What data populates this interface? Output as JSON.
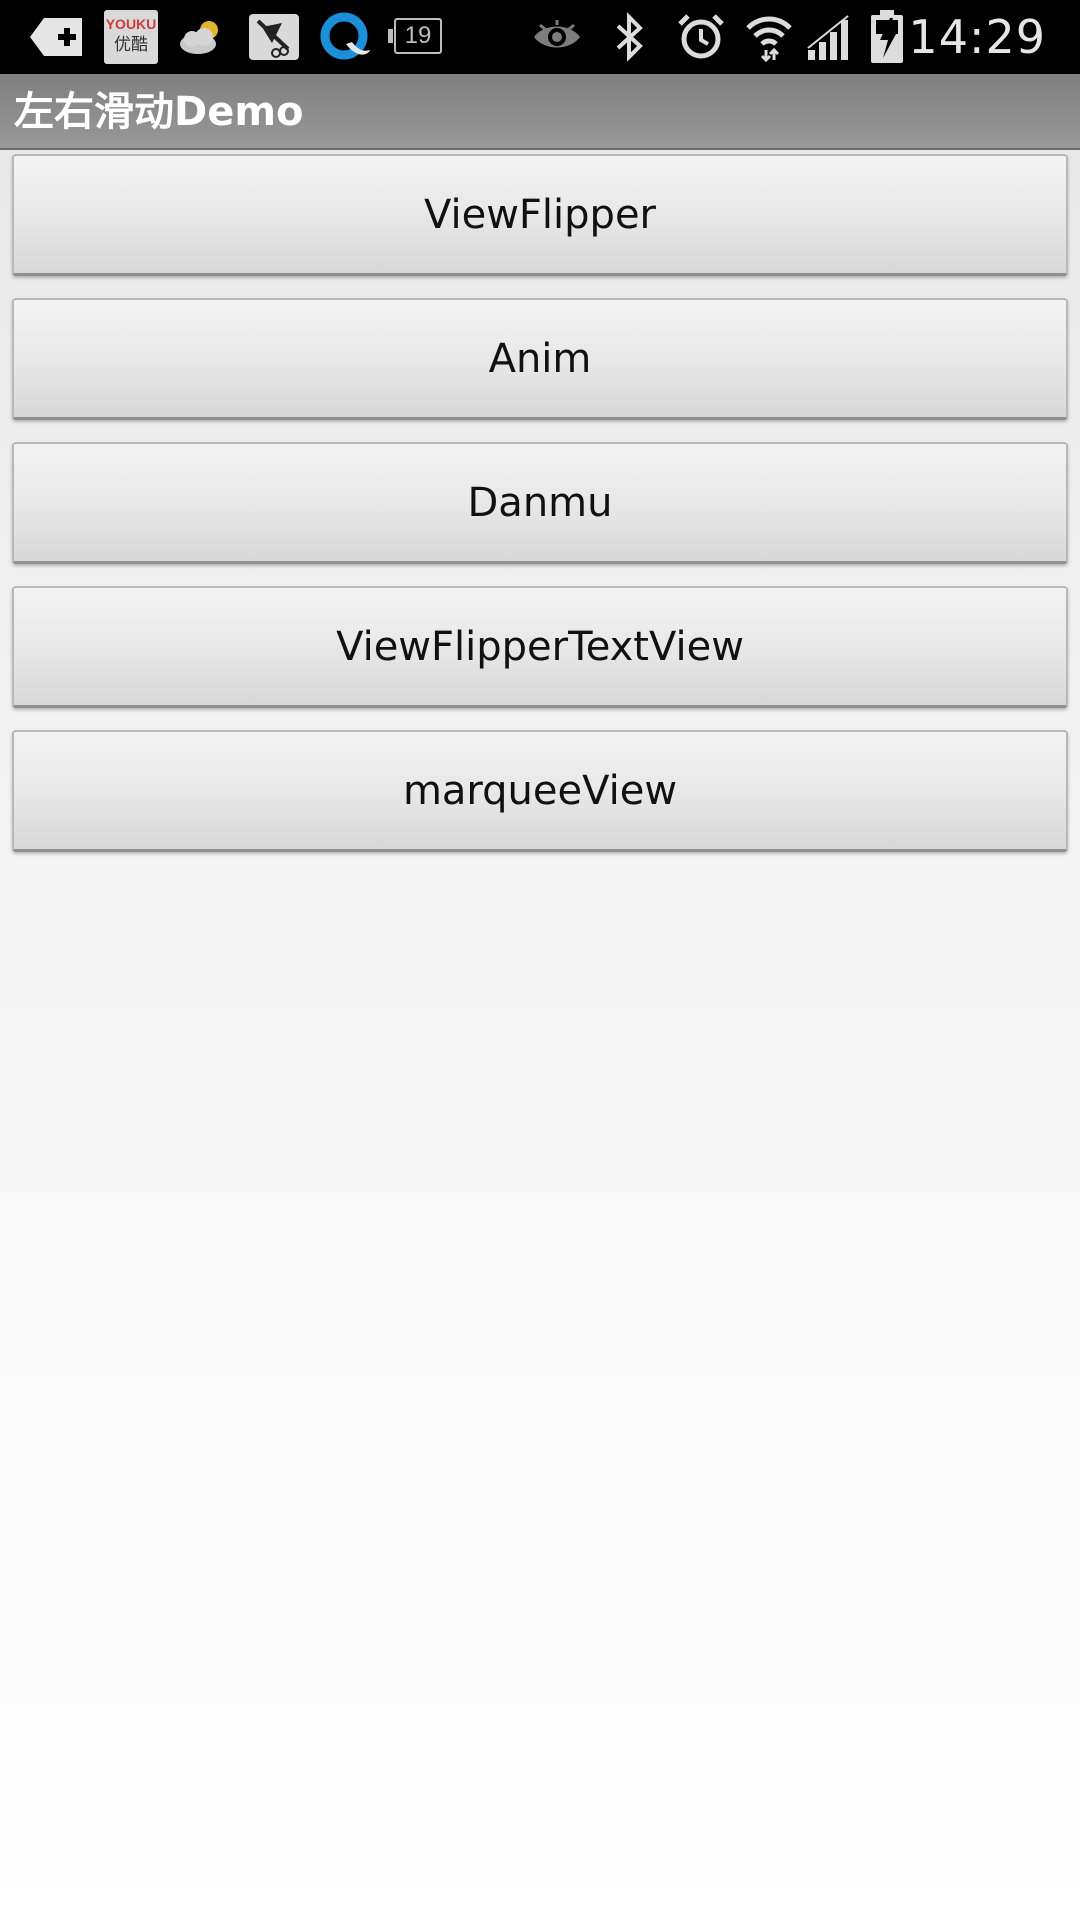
{
  "status_bar": {
    "time": "14:29",
    "notification_icons": [
      "add-icon",
      "youku-icon",
      "weather-cloud-icon",
      "scissors-app-icon",
      "qq-browser-icon",
      "battery-19-icon"
    ],
    "youku_label_top": "YOUKU",
    "youku_label_bottom": "优酷",
    "battery_level_text": "19",
    "system_icons": [
      "eye-icon",
      "bluetooth-icon",
      "alarm-icon",
      "wifi-icon",
      "signal-icon",
      "battery-charging-icon"
    ]
  },
  "action_bar": {
    "title": "左右滑动Demo"
  },
  "buttons": [
    {
      "label": "ViewFlipper"
    },
    {
      "label": "Anim"
    },
    {
      "label": "Danmu"
    },
    {
      "label": "ViewFlipperTextView"
    },
    {
      "label": "marqueeView"
    }
  ],
  "colors": {
    "status_bar_bg": "#000000",
    "action_bar_bg": "#8e8e8e",
    "button_text": "#111111",
    "title_text": "#ffffff"
  }
}
